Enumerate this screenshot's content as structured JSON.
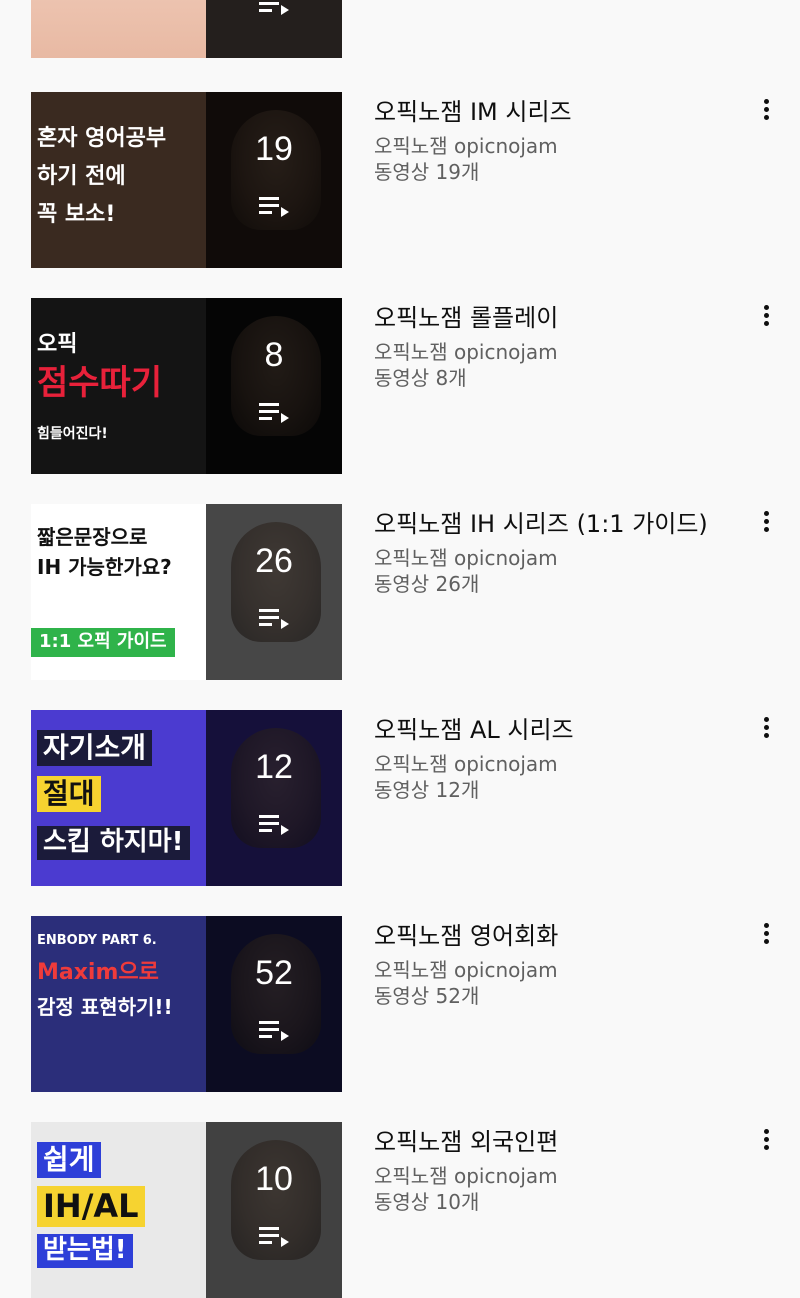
{
  "playlists": [
    {
      "title": "오픽노잼 IM 시리즈",
      "channel": "오픽노잼 opicnojam",
      "video_count_text": "동영상 19개",
      "count": "19",
      "thumb_text": [
        "혼자 영어공부",
        "하기 전에",
        "꼭 보소!"
      ],
      "thumb_colors": {
        "bg": "#3a2a20",
        "text": "#ffffff"
      }
    },
    {
      "title": "오픽노잼 롤플레이",
      "channel": "오픽노잼 opicnojam",
      "video_count_text": "동영상 8개",
      "count": "8",
      "thumb_text": [
        "오픽",
        "점수따기",
        "힘들어진다!"
      ],
      "thumb_colors": {
        "bg": "#141414",
        "text": "#ffffff",
        "accent": "#e8213a"
      }
    },
    {
      "title": "오픽노잼 IH 시리즈 (1:1 가이드)",
      "channel": "오픽노잼 opicnojam",
      "video_count_text": "동영상 26개",
      "count": "26",
      "thumb_text": [
        "짧은문장으로",
        "IH 가능한가요?",
        "1:1 오픽 가이드"
      ],
      "thumb_colors": {
        "bg": "#ffffff",
        "text": "#111111",
        "accent": "#2fb34a"
      }
    },
    {
      "title": "오픽노잼 AL 시리즈",
      "channel": "오픽노잼 opicnojam",
      "video_count_text": "동영상 12개",
      "count": "12",
      "thumb_text": [
        "자기소개",
        "절대",
        "스킵 하지마!"
      ],
      "thumb_colors": {
        "bg": "#4b3bd0",
        "text": "#ffffff",
        "accent": "#f6d330"
      }
    },
    {
      "title": "오픽노잼 영어회화",
      "channel": "오픽노잼 opicnojam",
      "video_count_text": "동영상 52개",
      "count": "52",
      "thumb_text": [
        "ENBODY PART 6.",
        "Maxim으로",
        "감정 표현하기!!"
      ],
      "thumb_colors": {
        "bg": "#2b2e7a",
        "text": "#ffffff",
        "accent": "#ef3b3b"
      }
    },
    {
      "title": "오픽노잼 외국인편",
      "channel": "오픽노잼 opicnojam",
      "video_count_text": "동영상 10개",
      "count": "10",
      "thumb_text": [
        "쉽게",
        "IH/AL",
        "받는법!"
      ],
      "thumb_colors": {
        "bg": "#e9e9e9",
        "text": "#1a1a1a",
        "accent": "#f6d330"
      }
    }
  ],
  "icons": {
    "playlist": "playlist-icon",
    "menu": "more-vert-icon"
  }
}
